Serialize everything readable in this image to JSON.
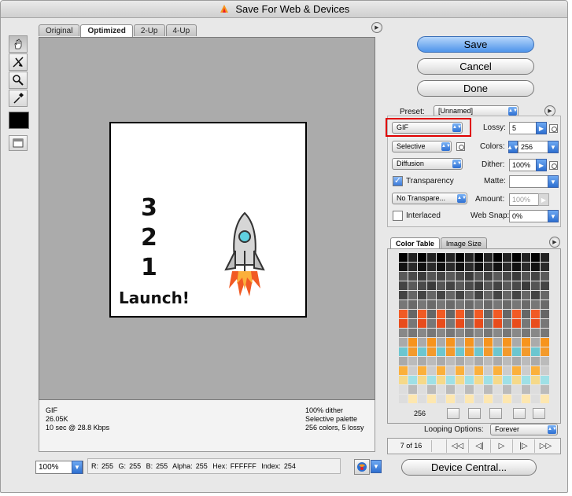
{
  "window": {
    "title": "Save For Web & Devices"
  },
  "tabs": [
    "Original",
    "Optimized",
    "2-Up",
    "4-Up"
  ],
  "active_tab": "Optimized",
  "artwork": {
    "countdown": [
      "3",
      "2",
      "1"
    ],
    "launch_text": "Launch!"
  },
  "info": {
    "format": "GIF",
    "size": "26.05K",
    "speed": "10 sec @ 28.8 Kbps",
    "dither": "100% dither",
    "palette": "Selective palette",
    "colors_lossy": "256 colors, 5 lossy"
  },
  "status": {
    "zoom": "100%",
    "r_label": "R:",
    "r": "255",
    "g_label": "G:",
    "g": "255",
    "b_label": "B:",
    "b": "255",
    "alpha_label": "Alpha:",
    "alpha": "255",
    "hex_label": "Hex:",
    "hex": "FFFFFF",
    "index_label": "Index:",
    "index": "254"
  },
  "buttons": {
    "save": "Save",
    "cancel": "Cancel",
    "done": "Done",
    "device_central": "Device Central..."
  },
  "settings": {
    "preset_label": "Preset:",
    "preset_value": "[Unnamed]",
    "format_value": "GIF",
    "lossy_label": "Lossy:",
    "lossy_value": "5",
    "reduction_value": "Selective",
    "colors_label": "Colors:",
    "colors_value": "256",
    "dither_algo": "Diffusion",
    "dither_label": "Dither:",
    "dither_value": "100%",
    "transparency_label": "Transparency",
    "transparency_checked": true,
    "matte_label": "Matte:",
    "matte_value": "",
    "trans_dither": "No Transpare...",
    "amount_label": "Amount:",
    "amount_value": "100%",
    "interlaced_label": "Interlaced",
    "interlaced_checked": false,
    "websnap_label": "Web Snap:",
    "websnap_value": "0%"
  },
  "color_table": {
    "tabs": [
      "Color Table",
      "Image Size"
    ],
    "count": "256"
  },
  "animation": {
    "looping_label": "Looping Options:",
    "looping_value": "Forever",
    "frame": "7 of 16"
  },
  "colors": {
    "primary_blue": "#4f94ea",
    "highlight_red": "#e00000",
    "canvas_gray": "#ababab",
    "rocket_flame": "#f15a24"
  },
  "icons": [
    "hand-tool-icon",
    "slice-select-icon",
    "zoom-icon",
    "eyedropper-icon",
    "toggle-slices-icon",
    "panel-menu-icon",
    "browser-preview-icon"
  ]
}
